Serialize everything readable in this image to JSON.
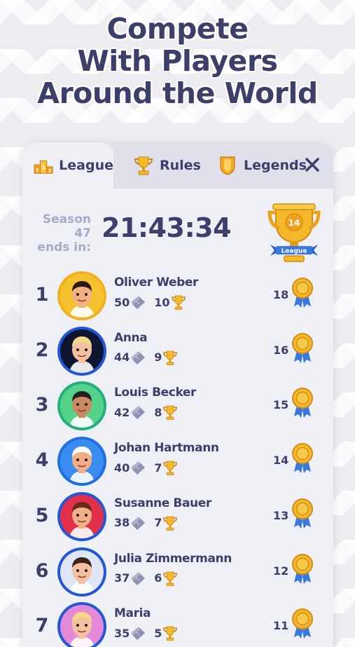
{
  "headline": {
    "line1": "Compete",
    "line2": "With Players",
    "line3": "Around the World"
  },
  "tabs": [
    {
      "label": "League",
      "icon": "podium-icon",
      "active": true
    },
    {
      "label": "Rules",
      "icon": "trophy-icon",
      "active": false
    },
    {
      "label": "Legends",
      "icon": "legend-badge-icon",
      "active": false
    }
  ],
  "season": {
    "label_line1": "Season 47",
    "label_line2": "ends in:",
    "timer": "21:43:34"
  },
  "league_cup": {
    "number": "14",
    "ribbon": "League"
  },
  "players": [
    {
      "rank": "1",
      "name": "Oliver Weber",
      "tickets": "50",
      "trophies": "10",
      "score": "18",
      "ring": "#f2b01e",
      "bg": "#f6c12f",
      "skin": "#f1b184",
      "hair": "#2a1a12"
    },
    {
      "rank": "2",
      "name": "Anna",
      "tickets": "44",
      "trophies": "9",
      "score": "16",
      "ring": "#2457d6",
      "bg": "#0d1530",
      "skin": "#f3c1a0",
      "hair": "#f2d98a"
    },
    {
      "rank": "3",
      "name": "Louis Becker",
      "tickets": "42",
      "trophies": "8",
      "score": "15",
      "ring": "#23b07a",
      "bg": "#56d38a",
      "skin": "#c98a62",
      "hair": "#222222"
    },
    {
      "rank": "4",
      "name": "Johan Hartmann",
      "tickets": "40",
      "trophies": "7",
      "score": "14",
      "ring": "#1f6fe0",
      "bg": "#3a8cf0",
      "skin": "#f0ad86",
      "hair": "#ffffff"
    },
    {
      "rank": "5",
      "name": "Susanne Bauer",
      "tickets": "38",
      "trophies": "7",
      "score": "13",
      "ring": "#2457d6",
      "bg": "#e2304a",
      "skin": "#f1b08a",
      "hair": "#6b2a18"
    },
    {
      "rank": "6",
      "name": "Julia Zimmermann",
      "tickets": "37",
      "trophies": "6",
      "score": "12",
      "ring": "#2457d6",
      "bg": "#dfe6f5",
      "skin": "#f3c1a0",
      "hair": "#3a2418"
    },
    {
      "rank": "7",
      "name": "Maria",
      "tickets": "35",
      "trophies": "5",
      "score": "11",
      "ring": "#2457d6",
      "bg": "#e58ad8",
      "skin": "#f3c1a0",
      "hair": "#f2d98a"
    }
  ],
  "colors": {
    "text": "#3d3f6b",
    "muted": "#a7a9c5",
    "gold": "#f5b82a",
    "ribbon": "#3a78e0",
    "tabbar": "#dfe0ea",
    "panel": "#eff0f6"
  }
}
